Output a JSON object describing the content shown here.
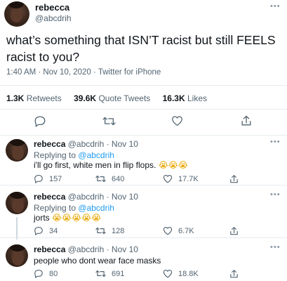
{
  "main_tweet": {
    "name": "rebecca",
    "handle": "@abcdrih",
    "text": "what’s something that ISN’T racist but still FEELS racist to you?",
    "meta": "1:40 AM · Nov 10, 2020 · Twitter for iPhone",
    "stats": {
      "retweets_count": "1.3K",
      "retweets_label": "Retweets",
      "quotes_count": "39.6K",
      "quotes_label": "Quote Tweets",
      "likes_count": "16.3K",
      "likes_label": "Likes"
    }
  },
  "replies": [
    {
      "name": "rebecca",
      "sub": "@abcdrih · Nov 10",
      "replying_prefix": "Replying to",
      "replying_to": "@abcdrih",
      "text": "i'll go first, white men in flip flops.",
      "emojis": "😭😭😭",
      "counts": {
        "reply": "157",
        "retweet": "640",
        "like": "17.7K"
      }
    },
    {
      "name": "rebecca",
      "sub": "@abcdrih · Nov 10",
      "replying_prefix": "Replying to",
      "replying_to": "@abcdrih",
      "text": "jorts",
      "emojis": "😭😭😭😭😭",
      "counts": {
        "reply": "34",
        "retweet": "128",
        "like": "6.7K"
      }
    },
    {
      "name": "rebecca",
      "sub": "@abcdrih · Nov 10",
      "text": "people who dont wear face masks",
      "counts": {
        "reply": "80",
        "retweet": "691",
        "like": "18.8K"
      }
    }
  ],
  "icons": {
    "more": "more-horizontal-icon",
    "reply": "comment-bubble-icon",
    "retweet": "retweet-arrows-icon",
    "like": "heart-icon",
    "share": "share-upload-icon"
  },
  "colors": {
    "text": "#0f1419",
    "secondary": "#536471",
    "link": "#1d9bf0",
    "divider": "#e6ecf0"
  }
}
